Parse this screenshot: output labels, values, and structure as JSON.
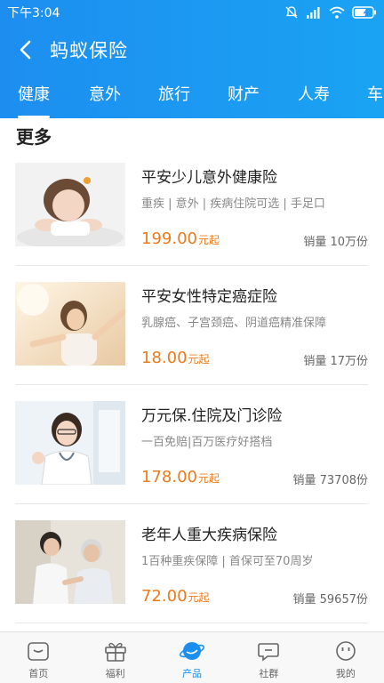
{
  "status_bar": {
    "time": "下午3:04"
  },
  "header": {
    "title": "蚂蚁保险"
  },
  "tabs": [
    {
      "label": "健康",
      "active": true
    },
    {
      "label": "意外",
      "active": false
    },
    {
      "label": "旅行",
      "active": false
    },
    {
      "label": "财产",
      "active": false
    },
    {
      "label": "人寿",
      "active": false
    },
    {
      "label": "车",
      "active": false
    }
  ],
  "section": {
    "title": "更多"
  },
  "products": [
    {
      "name": "平安少儿意外健康险",
      "tags": "重疾 | 意外 | 疾病住院可选 | 手足口",
      "price": "199.00",
      "price_unit": "元起",
      "sales": "销量 10万份"
    },
    {
      "name": "平安女性特定癌症险",
      "tags": "乳腺癌、子宫颈癌、阴道癌精准保障",
      "price": "18.00",
      "price_unit": "元起",
      "sales": "销量 17万份"
    },
    {
      "name": "万元保.住院及门诊险",
      "tags": "一百免赔|百万医疗好搭档",
      "price": "178.00",
      "price_unit": "元起",
      "sales": "销量 73708份"
    },
    {
      "name": "老年人重大疾病保险",
      "tags": "1百种重疾保障 | 首保可至70周岁",
      "price": "72.00",
      "price_unit": "元起",
      "sales": "销量 59657份"
    }
  ],
  "bottom_nav": [
    {
      "label": "首页",
      "icon": "home-icon",
      "active": false
    },
    {
      "label": "福利",
      "icon": "gift-icon",
      "active": false
    },
    {
      "label": "产品",
      "icon": "planet-icon",
      "active": true
    },
    {
      "label": "社群",
      "icon": "chat-icon",
      "active": false
    },
    {
      "label": "我的",
      "icon": "smiley-icon",
      "active": false
    }
  ],
  "colors": {
    "header_start": "#1d8ef0",
    "header_end": "#1aa3f3",
    "price": "#ee7a1a",
    "nav_active": "#1a8ff0"
  }
}
